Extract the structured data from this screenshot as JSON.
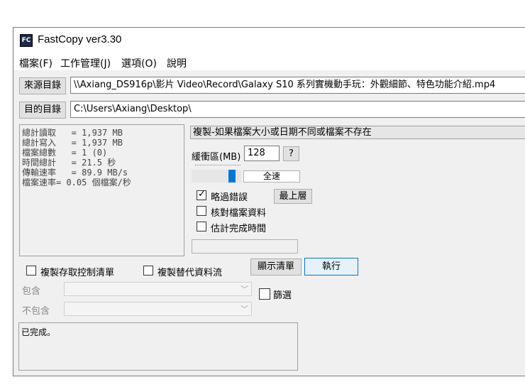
{
  "window": {
    "title": "FastCopy ver3.30",
    "icon_text": "FC"
  },
  "menu": [
    "檔案(F)",
    "工作管理(J)",
    "選項(O)",
    "說明"
  ],
  "source": {
    "button": "來源目錄",
    "path": "\\\\Axiang_DS916p\\影片 Video\\Record\\Galaxy S10 系列實機動手玩：外觀細節、特色功能介紹.mp4"
  },
  "dest": {
    "button": "目的目錄",
    "path": "C:\\Users\\Axiang\\Desktop\\"
  },
  "stats": [
    "總計讀取   = 1,937 MB",
    "總計寫入   = 1,937 MB",
    "檔案總數   = 1 (0)",
    "時間總計   = 21.5 秒",
    "傳輸速率   = 89.9 MB/s",
    "檔案速率= 0.05 個檔案/秒"
  ],
  "mode": "複製-如果檔案大小或日期不同或檔案不存在",
  "buffer": {
    "label": "緩衝區(MB)",
    "value": "128",
    "help": "?"
  },
  "speed": {
    "label": "全速",
    "level": 0.8
  },
  "options": {
    "ignore_errors": {
      "label": "略過錯誤",
      "checked": true
    },
    "verify": {
      "label": "核對檔案資料",
      "checked": false
    },
    "estimate": {
      "label": "估計完成時間",
      "checked": false
    },
    "topmost": "最上層"
  },
  "acl": {
    "label": "複製存取控制清單",
    "checked": false
  },
  "streams": {
    "label": "複製替代資料流",
    "checked": false
  },
  "list_button": "顯示清單",
  "run_button": "執行",
  "include": {
    "label": "包含",
    "value": ""
  },
  "exclude": {
    "label": "不包含",
    "value": ""
  },
  "filter": {
    "label": "篩選",
    "checked": false
  },
  "status_text": "已完成。"
}
